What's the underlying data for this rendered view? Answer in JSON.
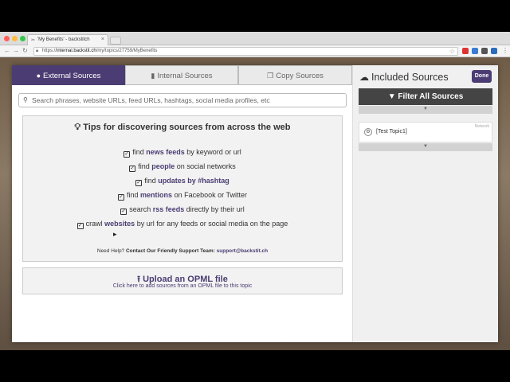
{
  "browser": {
    "tab_title": "'My Benefits' - backstitch",
    "url_prefix": "https://",
    "url_host": "internal.backstit.ch",
    "url_path": "/my/topics/27759/MyBenefits"
  },
  "source_tabs": [
    {
      "label": "External Sources",
      "icon": "globe-icon",
      "active": true
    },
    {
      "label": "Internal Sources",
      "icon": "book-icon",
      "active": false
    },
    {
      "label": "Copy Sources",
      "icon": "copy-icon",
      "active": false
    }
  ],
  "search": {
    "placeholder": "Search phrases,  website URLs, feed URLs, hashtags, social media profiles, etc"
  },
  "tips": {
    "title": "Tips for discovering sources from across the web",
    "items": [
      {
        "pre": "find ",
        "hl": "news feeds",
        "post": " by keyword or url"
      },
      {
        "pre": "find ",
        "hl": "people",
        "post": " on social networks"
      },
      {
        "pre": "find ",
        "hl": "updates by #hashtag",
        "post": ""
      },
      {
        "pre": "find ",
        "hl": "mentions",
        "post": " on Facebook or Twitter"
      },
      {
        "pre": "search ",
        "hl": "rss feeds",
        "post": " directly by their url"
      },
      {
        "pre": "crawl ",
        "hl": "websites",
        "post": " by url for any feeds or social media on the page"
      }
    ],
    "help_prefix": "Need Help?",
    "help_bold": "Contact Our Friendly Support Team:",
    "help_email": "support@backstit.ch"
  },
  "opml": {
    "title": "Upload an OPML file",
    "sub": "Click here to add sources from an OPML file to this topic"
  },
  "included": {
    "title": "Included Sources",
    "done_label": "Done",
    "filter_label": "Filter All Sources",
    "topic_name": "[Test Topic1]",
    "topic_network": "Network"
  },
  "colors": {
    "accent": "#4b3d73",
    "filter_bg": "#444444"
  }
}
